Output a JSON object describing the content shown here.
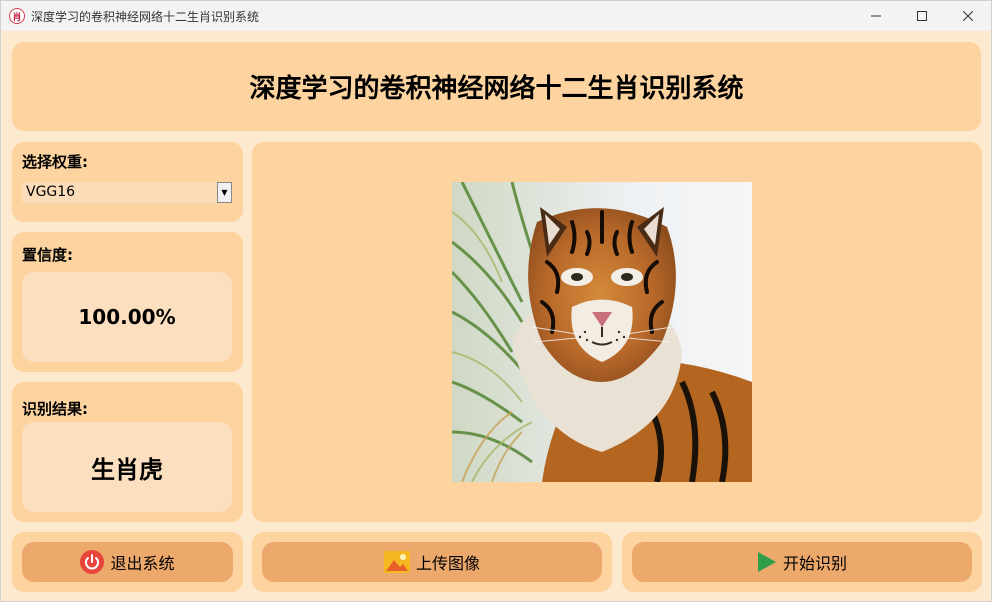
{
  "window": {
    "title": "深度学习的卷积神经网络十二生肖识别系统",
    "app_icon_glyph": "肖",
    "controls": [
      "minimize-icon",
      "maximize-icon",
      "close-icon"
    ]
  },
  "header": {
    "title": "深度学习的卷积神经网络十二生肖识别系统"
  },
  "weights": {
    "label": "选择权重:",
    "selected": "VGG16"
  },
  "confidence": {
    "label": "置信度:",
    "value": "100.00%"
  },
  "result": {
    "label": "识别结果:",
    "value": "生肖虎"
  },
  "image": {
    "subject": "tiger-portrait"
  },
  "buttons": {
    "exit": {
      "label": "退出系统",
      "icon": "power-icon"
    },
    "upload": {
      "label": "上传图像",
      "icon": "image-icon"
    },
    "start": {
      "label": "开始识别",
      "icon": "play-icon"
    }
  },
  "colors": {
    "window_bg": "#fde9cd",
    "panel_bg": "#fdd39f",
    "box_bg": "#fcdfbe",
    "button_bg": "#eda86b",
    "power_red": "#e8453c",
    "play_green": "#2e9e4b",
    "image_yellow": "#f5b820"
  }
}
